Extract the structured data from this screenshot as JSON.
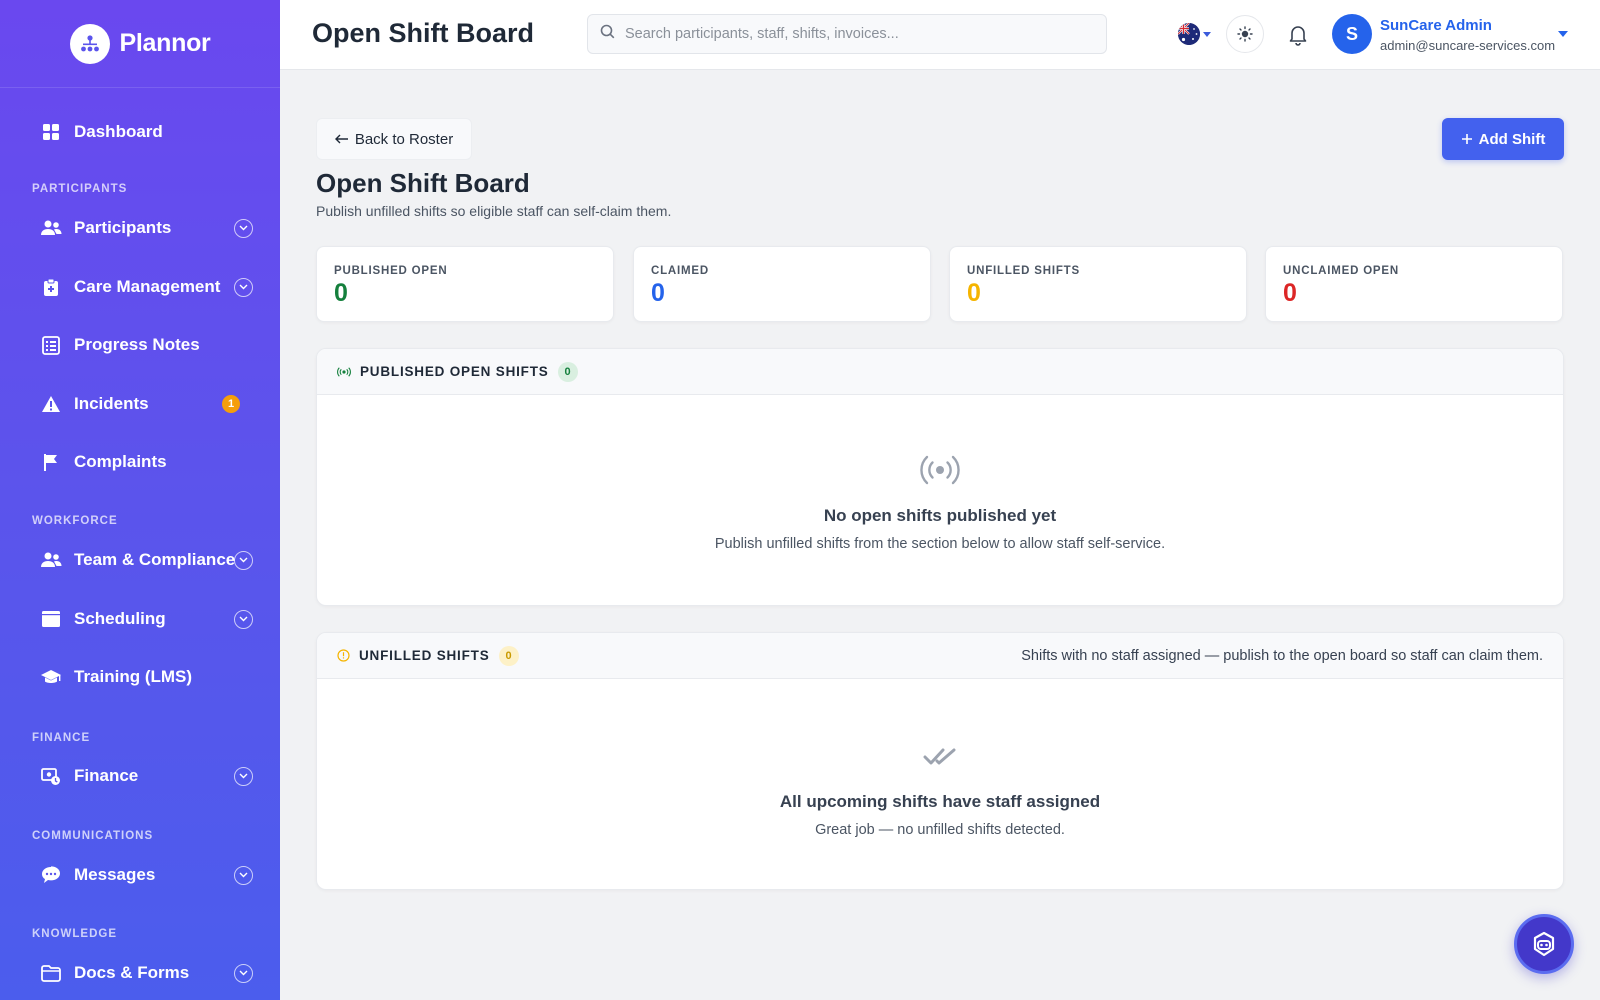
{
  "brand": {
    "name": "Plannor"
  },
  "sidebar": {
    "items": {
      "dashboard": {
        "label": "Dashboard"
      },
      "participants": {
        "label": "Participants"
      },
      "care": {
        "label": "Care Management"
      },
      "notes": {
        "label": "Progress Notes"
      },
      "incidents": {
        "label": "Incidents",
        "badge": "1"
      },
      "complaints": {
        "label": "Complaints"
      },
      "team": {
        "label": "Team & Compliance"
      },
      "scheduling": {
        "label": "Scheduling"
      },
      "training": {
        "label": "Training (LMS)"
      },
      "finance": {
        "label": "Finance"
      },
      "messages": {
        "label": "Messages"
      },
      "docs": {
        "label": "Docs & Forms"
      }
    },
    "sections": {
      "participants": "PARTICIPANTS",
      "workforce": "WORKFORCE",
      "finance": "FINANCE",
      "communications": "COMMUNICATIONS",
      "knowledge": "KNOWLEDGE"
    }
  },
  "header": {
    "title": "Open Shift Board",
    "search_placeholder": "Search participants, staff, shifts, invoices...",
    "user": {
      "initial": "S",
      "name": "SunCare Admin",
      "email": "admin@suncare-services.com"
    }
  },
  "page": {
    "back_label": "Back to Roster",
    "add_label": "Add Shift",
    "title": "Open Shift Board",
    "subtitle": "Publish unfilled shifts so eligible staff can self-claim them."
  },
  "stats": [
    {
      "label": "PUBLISHED OPEN",
      "value": "0",
      "color": "#15803d"
    },
    {
      "label": "CLAIMED",
      "value": "0",
      "color": "#2563eb"
    },
    {
      "label": "UNFILLED SHIFTS",
      "value": "0",
      "color": "#f5b400"
    },
    {
      "label": "UNCLAIMED OPEN",
      "value": "0",
      "color": "#dc2626"
    }
  ],
  "published_panel": {
    "title": "PUBLISHED OPEN SHIFTS",
    "count": "0",
    "empty_title": "No open shifts published yet",
    "empty_sub": "Publish unfilled shifts from the section below to allow staff self-service."
  },
  "unfilled_panel": {
    "title": "UNFILLED SHIFTS",
    "count": "0",
    "note": "Shifts with no staff assigned — publish to the open board so staff can claim them.",
    "empty_title": "All upcoming shifts have staff assigned",
    "empty_sub": "Great job — no unfilled shifts detected."
  },
  "colors": {
    "accent": "#4361ee",
    "sidebar_top": "#6a48ef",
    "sidebar_bottom": "#4b5ded"
  }
}
